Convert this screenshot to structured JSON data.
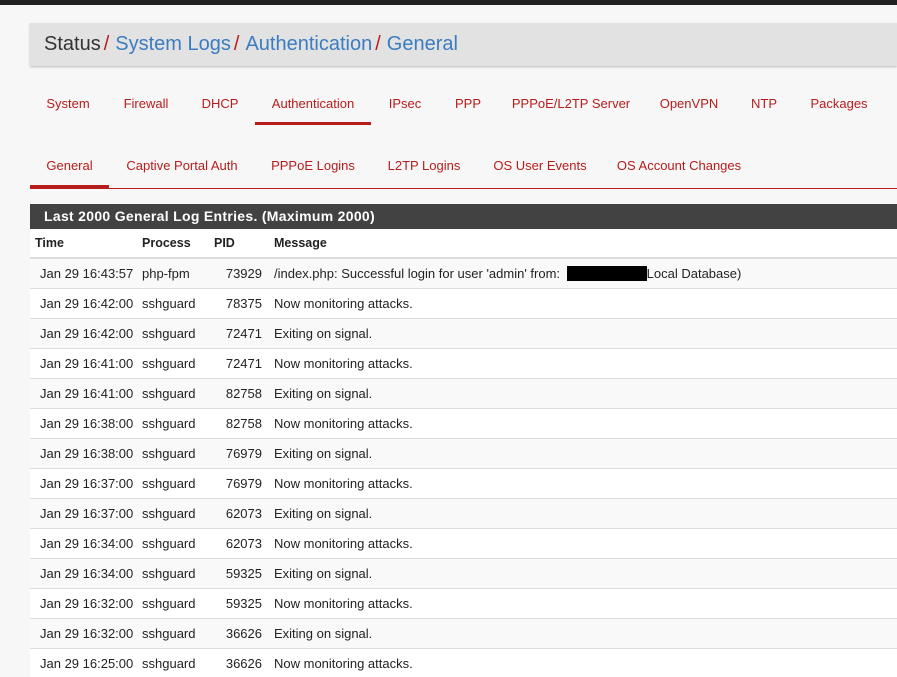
{
  "breadcrumb": {
    "status": "Status",
    "sep": "/",
    "system_logs": "System Logs",
    "authentication": "Authentication",
    "general": "General"
  },
  "main_tabs": [
    "System",
    "Firewall",
    "DHCP",
    "Authentication",
    "IPsec",
    "PPP",
    "PPPoE/L2TP Server",
    "OpenVPN",
    "NTP",
    "Packages"
  ],
  "main_tab_active": "Authentication",
  "sub_tabs": [
    "General",
    "Captive Portal Auth",
    "PPPoE Logins",
    "L2TP Logins",
    "OS User Events",
    "OS Account Changes"
  ],
  "sub_tab_active": "General",
  "panel": {
    "title": "Last 2000 General Log Entries. (Maximum 2000)",
    "columns": {
      "time": "Time",
      "process": "Process",
      "pid": "PID",
      "message": "Message"
    },
    "rows": [
      {
        "time": "Jan 29 16:43:57",
        "process": "php-fpm",
        "pid": "73929",
        "message_pre": "/index.php: Successful login for user 'admin' from: ",
        "redacted": true,
        "message_post": "Local Database)"
      },
      {
        "time": "Jan 29 16:42:00",
        "process": "sshguard",
        "pid": "78375",
        "message": "Now monitoring attacks."
      },
      {
        "time": "Jan 29 16:42:00",
        "process": "sshguard",
        "pid": "72471",
        "message": "Exiting on signal."
      },
      {
        "time": "Jan 29 16:41:00",
        "process": "sshguard",
        "pid": "72471",
        "message": "Now monitoring attacks."
      },
      {
        "time": "Jan 29 16:41:00",
        "process": "sshguard",
        "pid": "82758",
        "message": "Exiting on signal."
      },
      {
        "time": "Jan 29 16:38:00",
        "process": "sshguard",
        "pid": "82758",
        "message": "Now monitoring attacks."
      },
      {
        "time": "Jan 29 16:38:00",
        "process": "sshguard",
        "pid": "76979",
        "message": "Exiting on signal."
      },
      {
        "time": "Jan 29 16:37:00",
        "process": "sshguard",
        "pid": "76979",
        "message": "Now monitoring attacks."
      },
      {
        "time": "Jan 29 16:37:00",
        "process": "sshguard",
        "pid": "62073",
        "message": "Exiting on signal."
      },
      {
        "time": "Jan 29 16:34:00",
        "process": "sshguard",
        "pid": "62073",
        "message": "Now monitoring attacks."
      },
      {
        "time": "Jan 29 16:34:00",
        "process": "sshguard",
        "pid": "59325",
        "message": "Exiting on signal."
      },
      {
        "time": "Jan 29 16:32:00",
        "process": "sshguard",
        "pid": "59325",
        "message": "Now monitoring attacks."
      },
      {
        "time": "Jan 29 16:32:00",
        "process": "sshguard",
        "pid": "36626",
        "message": "Exiting on signal."
      },
      {
        "time": "Jan 29 16:25:00",
        "process": "sshguard",
        "pid": "36626",
        "message": "Now monitoring attacks."
      },
      {
        "time": "",
        "process": "",
        "pid": "",
        "message": ""
      }
    ]
  },
  "colors": {
    "accent": "#b71c1c",
    "link": "#3b7cc1",
    "heading_bg": "#424242"
  }
}
